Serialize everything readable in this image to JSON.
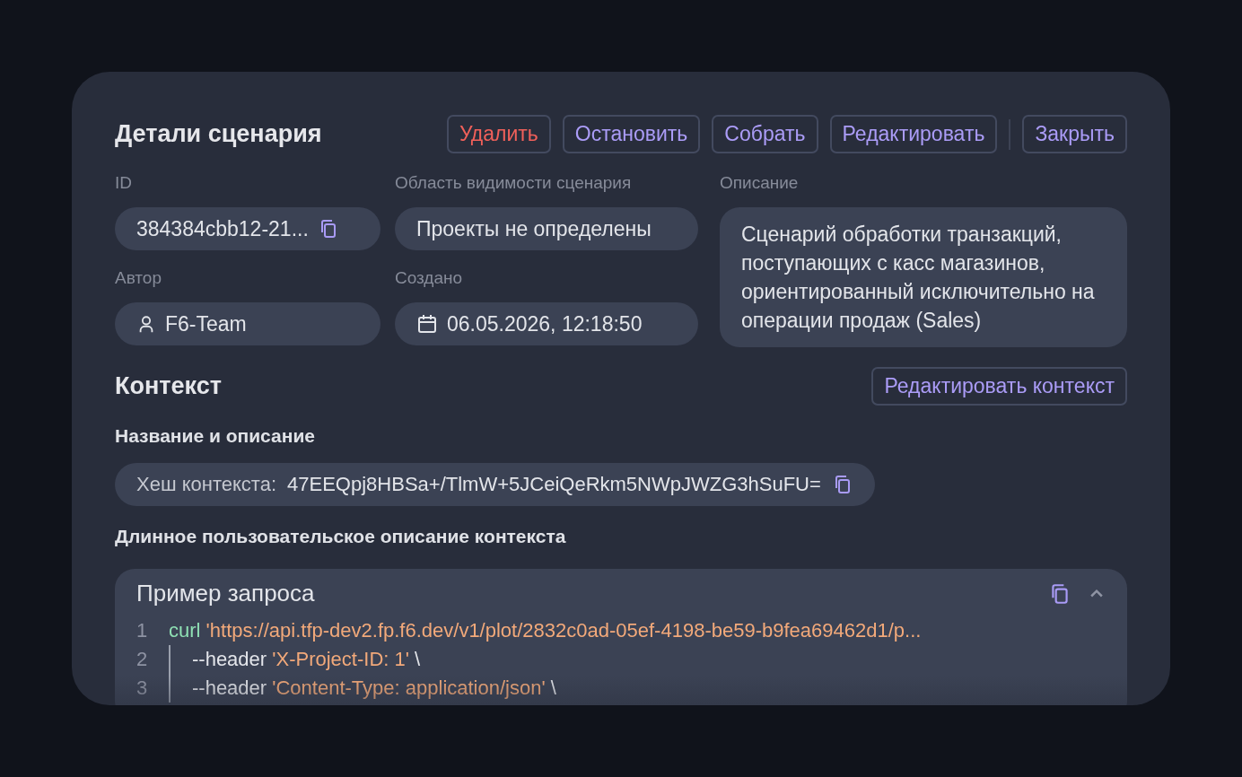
{
  "header": {
    "title": "Детали сценария"
  },
  "actions": [
    {
      "label": "Удалить",
      "kind": "danger"
    },
    {
      "label": "Остановить",
      "kind": "primary"
    },
    {
      "label": "Собрать",
      "kind": "primary"
    },
    {
      "label": "Редактировать",
      "kind": "primary"
    },
    {
      "kind": "divider"
    },
    {
      "label": "Закрыть",
      "kind": "primary"
    }
  ],
  "fields": {
    "id": {
      "label": "ID",
      "value": "384384cbb12-21..."
    },
    "scope": {
      "label": "Область видимости сценария",
      "value": "Проекты не определены"
    },
    "description": {
      "label": "Описание",
      "value": "Сценарий обработки транзакций, поступающих с касс магазинов, ориентированный исключительно на операции продаж (Sales)"
    },
    "author": {
      "label": "Автор",
      "value": "F6-Team"
    },
    "created": {
      "label": "Создано",
      "value": "06.05.2026, 12:18:50"
    }
  },
  "context": {
    "title": "Контекст",
    "edit_button": "Редактировать контекст",
    "subtitle": "Название и описание",
    "hash_label": "Хеш контекста:",
    "hash_value": "47EEQpj8HBSa+/TlmW+5JCeiQeRkm5NWpJWZG3hSuFU=",
    "long_description_title": "Длинное пользовательское описание контекста"
  },
  "request_example": {
    "title": "Пример запроса",
    "expanded": true,
    "lines": [
      {
        "number": "1",
        "tokens": [
          {
            "text": "curl",
            "kind": "command"
          },
          {
            "text": "'https://api.tfp-dev2.fp.f6.dev/v1/plot/2832c0ad-05ef-4198-be59-b9fea69462d1/p...",
            "kind": "string"
          }
        ]
      },
      {
        "number": "2",
        "tokens": [
          {
            "text": "--header",
            "kind": "plain"
          },
          {
            "text": "'X-Project-ID: 1'",
            "kind": "string"
          },
          {
            "text": "\\",
            "kind": "plain"
          }
        ]
      },
      {
        "number": "3",
        "tokens": [
          {
            "text": "--header",
            "kind": "plain"
          },
          {
            "text": "'Content-Type: application/json'",
            "kind": "string"
          },
          {
            "text": "\\",
            "kind": "plain"
          }
        ]
      }
    ]
  }
}
